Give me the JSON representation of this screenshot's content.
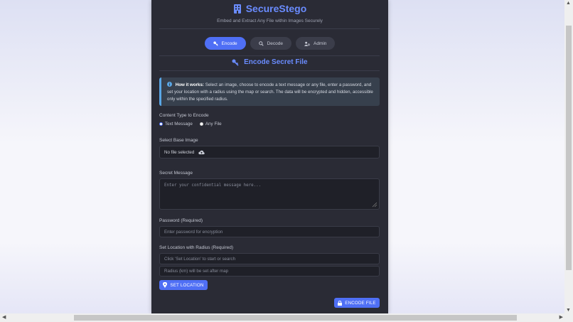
{
  "brand": {
    "title": "SecureStego",
    "subtitle": "Embed and Extract Any File within Images Securely"
  },
  "tabs": [
    {
      "label": "Encode",
      "active": true,
      "icon": "key-icon"
    },
    {
      "label": "Decode",
      "active": false,
      "icon": "search-icon"
    },
    {
      "label": "Admin",
      "active": false,
      "icon": "user-gear-icon"
    }
  ],
  "section": {
    "title": "Encode Secret File"
  },
  "info": {
    "heading": "How it works:",
    "text": "Select an image, choose to encode a text message or any file, enter a password, and set your location with a radius using the map or search. The data will be encrypted and hidden, accessible only within the specified radius."
  },
  "content_type": {
    "label": "Content Type to Encode",
    "options": [
      "Text Message",
      "Any File"
    ],
    "selected": "Text Message"
  },
  "base_image": {
    "label": "Select Base Image",
    "value": "No file selected"
  },
  "secret_message": {
    "label": "Secret Message",
    "placeholder": "Enter your confidential message here..."
  },
  "password": {
    "label": "Password (Required)",
    "placeholder": "Enter password for encryption"
  },
  "location": {
    "label": "Set Location with Radius (Required)",
    "location_placeholder": "Click 'Set Location' to start or search",
    "radius_placeholder": "Radius (km) will be set after map",
    "button": "SET LOCATION"
  },
  "encode_button": "ENCODE FILE",
  "colors": {
    "accent": "#4f6ff5",
    "title": "#6a8cff",
    "panel": "#2a2b35"
  }
}
